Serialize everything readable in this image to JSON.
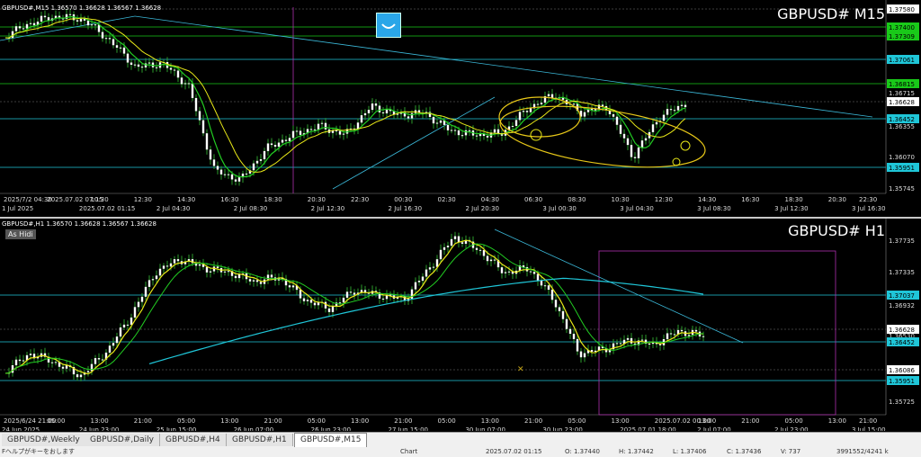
{
  "top_panel": {
    "header": "GBPUSD#,M15  1.36570 1.36628 1.36567 1.36628",
    "symbol_title": "GBPUSD# M15",
    "price_labels": [
      {
        "value": "1.37580",
        "style": "white"
      },
      {
        "value": "1.37400",
        "style": "green"
      },
      {
        "value": "1.37309",
        "style": "green"
      },
      {
        "value": "1.37061",
        "style": "cyan"
      },
      {
        "value": "1.36815",
        "style": "green"
      },
      {
        "value": "1.36715",
        "style": "plain"
      },
      {
        "value": "1.36628",
        "style": "white"
      },
      {
        "value": "1.36452",
        "style": "cyan"
      },
      {
        "value": "1.36355",
        "style": "plain"
      },
      {
        "value": "1.36070",
        "style": "plain"
      },
      {
        "value": "1.35951",
        "style": "cyan"
      },
      {
        "value": "1.35745",
        "style": "plain"
      }
    ],
    "time_row1": [
      "2025/7/2 04:30",
      "2025.07.02 07:15",
      "10:30",
      "12:30",
      "14:30",
      "16:30",
      "18:30",
      "20:30",
      "22:30",
      "00:30",
      "02:30",
      "04:30",
      "06:30",
      "08:30",
      "10:30",
      "12:30",
      "14:30",
      "16:30",
      "18:30",
      "20:30",
      "22:30"
    ],
    "time_row2": [
      "1 Jul 2025",
      "2025.07.02 01:15",
      "2 Jul 04:30",
      "2 Jul 08:30",
      "2 Jul 12:30",
      "2 Jul 16:30",
      "2 Jul 20:30",
      "3 Jul 00:30",
      "3 Jul 04:30",
      "3 Jul 08:30",
      "3 Jul 12:30",
      "3 Jul 16:30"
    ]
  },
  "bottom_panel": {
    "header": "GBPUSD#,H1  1.36570 1.36628 1.36567 1.36628",
    "symbol_title": "GBPUSD# H1",
    "as_hidi": "As Hidi",
    "price_labels": [
      {
        "value": "1.37735",
        "style": "plain"
      },
      {
        "value": "1.37335",
        "style": "plain"
      },
      {
        "value": "1.37037",
        "style": "cyan"
      },
      {
        "value": "1.36932",
        "style": "plain"
      },
      {
        "value": "1.36628",
        "style": "white"
      },
      {
        "value": "1.36530",
        "style": "plain"
      },
      {
        "value": "1.36452",
        "style": "cyan"
      },
      {
        "value": "1.36086",
        "style": "white"
      },
      {
        "value": "1.35951",
        "style": "cyan"
      },
      {
        "value": "1.35725",
        "style": "plain"
      }
    ],
    "time_row1": [
      "2025/6/24 21:00",
      "05:00",
      "13:00",
      "21:00",
      "05:00",
      "13:00",
      "21:00",
      "05:00",
      "13:00",
      "21:00",
      "05:00",
      "13:00",
      "21:00",
      "05:00",
      "13:00",
      "2025.07.02 00:00",
      "13:00",
      "21:00",
      "05:00",
      "13:00",
      "21:00"
    ],
    "time_row2": [
      "24 Jun 2025",
      "24 Jun 23:00",
      "25 Jun 15:00",
      "26 Jun 07:00",
      "26 Jun 23:00",
      "27 Jun 15:00",
      "30 Jun 07:00",
      "30 Jun 23:00",
      "2025.07.01 18:00",
      "2 Jul 07:00",
      "2 Jul 23:00",
      "3 Jul 15:00"
    ]
  },
  "tabs": [
    "GBPUSD#,Weekly",
    "GBPUSD#,Daily",
    "GBPUSD#,H4",
    "GBPUSD#,H1",
    "GBPUSD#,M15"
  ],
  "active_tab": "GBPUSD#,M15",
  "status_bar": {
    "left": "Fヘルプがキーをおします",
    "profile": "Chart",
    "datetime": "2025.07.02 01:15",
    "open": "O: 1.37440",
    "high": "H: 1.37442",
    "low": "L: 1.37406",
    "close": "C: 1.37436",
    "volume": "V: 737",
    "traffic": "3991552/4241 k"
  },
  "colors": {
    "cyan": "#1fc6d8",
    "green": "#19c919",
    "candle": "#ffffff",
    "wick": "#2d9c2d",
    "ma_yellow": "#e8e818",
    "ma_green": "#22cc22",
    "trend": "#3bb8d8"
  }
}
